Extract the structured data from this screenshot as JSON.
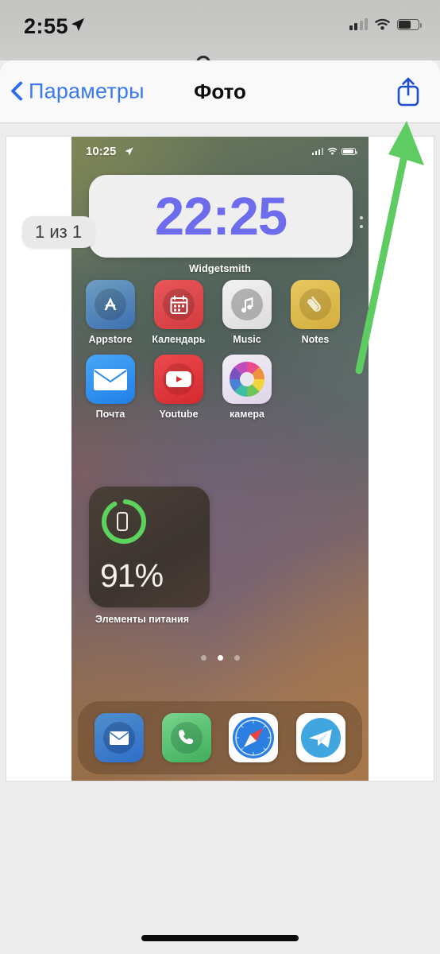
{
  "status_bar": {
    "time": "2:55",
    "location_icon": "location-arrow-icon",
    "signal_icon": "cellular-signal-icon",
    "wifi_icon": "wifi-icon",
    "battery_icon": "battery-icon"
  },
  "nav": {
    "back_label": "Параметры",
    "back_icon": "chevron-left-icon",
    "title": "Фото",
    "share_icon": "share-icon"
  },
  "photo_viewer": {
    "counter": "1 из 1"
  },
  "screenshot": {
    "status_bar": {
      "time": "10:25",
      "location_icon": "location-arrow-icon",
      "signal_icon": "cellular-signal-icon",
      "wifi_icon": "wifi-icon",
      "battery_icon": "battery-icon"
    },
    "widget_clock": {
      "time": "22:25",
      "label": "Widgetsmith",
      "time_color": "#6d6cec",
      "background": "#f0eff0"
    },
    "apps_row1": [
      {
        "name": "Appstore",
        "icon": "appstore-icon",
        "color": "#3d6fb3"
      },
      {
        "name": "Календарь",
        "icon": "calendar-icon",
        "color": "#d33b3f"
      },
      {
        "name": "Music",
        "icon": "music-note-icon",
        "color": "#dcdcdc"
      },
      {
        "name": "Notes",
        "icon": "paperclip-icon",
        "color": "#d4ae3e"
      }
    ],
    "apps_row2": [
      {
        "name": "Почта",
        "icon": "mail-envelope-icon",
        "color": "#1f7fe8"
      },
      {
        "name": "Youtube",
        "icon": "youtube-play-icon",
        "color": "#d5292f"
      },
      {
        "name": "камера",
        "icon": "color-wheel-icon",
        "color": "#ded4e8"
      }
    ],
    "battery_widget": {
      "percent": "91%",
      "label": "Элементы питания",
      "ring_color": "#5cd35c",
      "ring_fill": 91,
      "phone_icon": "phone-device-icon"
    },
    "page_dots": {
      "count": 3,
      "active_index": 1
    },
    "dock": [
      {
        "name": "mail",
        "icon": "mail-envelope-icon"
      },
      {
        "name": "phone",
        "icon": "phone-handset-icon"
      },
      {
        "name": "safari",
        "icon": "safari-compass-icon"
      },
      {
        "name": "telegram",
        "icon": "telegram-plane-icon"
      }
    ]
  },
  "annotation": {
    "arrow_icon": "green-pointer-arrow-icon",
    "color": "#5fcc63",
    "points_to": "share-icon"
  }
}
